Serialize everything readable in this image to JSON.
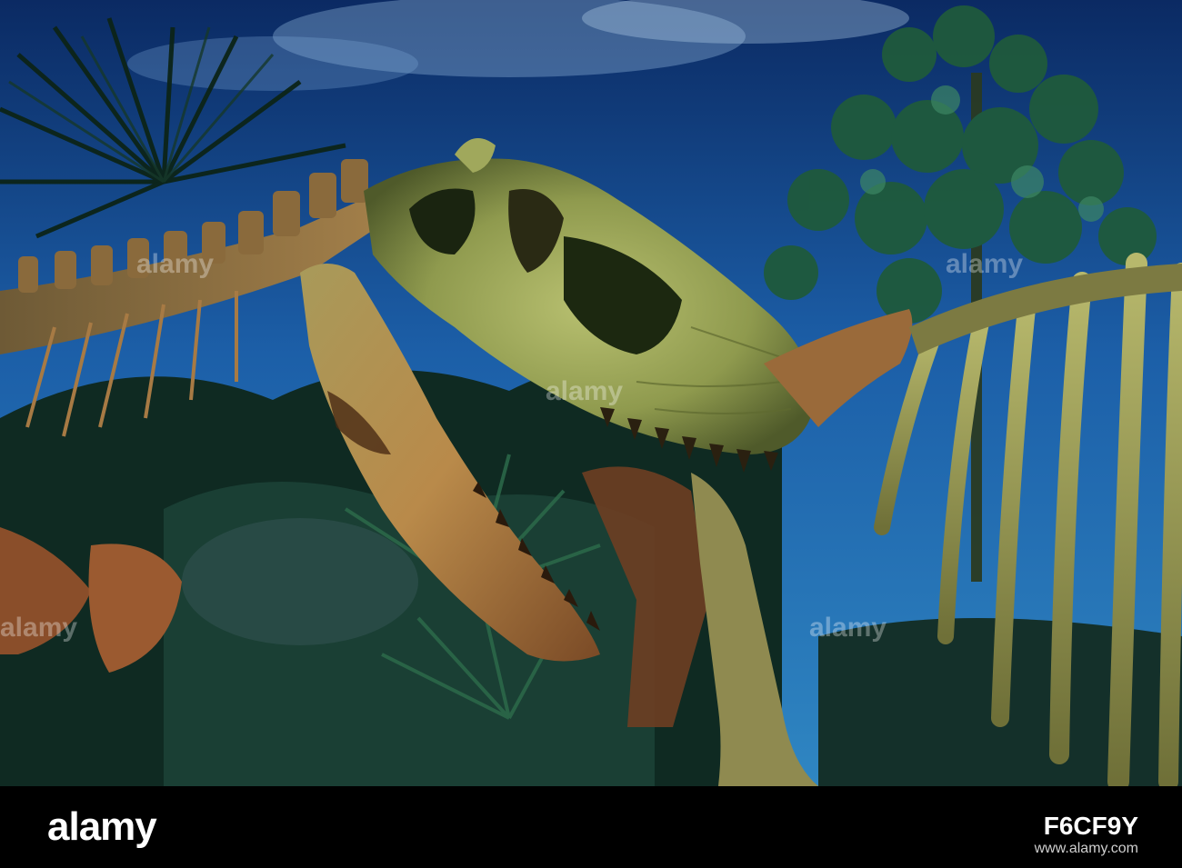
{
  "photo": {
    "subject": "dinosaur-skeleton",
    "colors": {
      "sky_top": "#0b2a63",
      "sky_mid": "#1c5fa8",
      "sky_low": "#2f86c2",
      "cloud": "#9fc4e6",
      "foliage_dark": "#0c2418",
      "foliage_mid": "#1f5a3c",
      "foliage_light": "#3f8a62",
      "bone_green": "#9aa85a",
      "bone_gold": "#b98a4a",
      "bone_rust": "#8a4e2a",
      "bone_dark": "#3a2a18"
    }
  },
  "watermark": {
    "label": "alamy"
  },
  "footer": {
    "brand": "alamy",
    "image_id": "F6CF9Y",
    "url": "www.alamy.com"
  }
}
